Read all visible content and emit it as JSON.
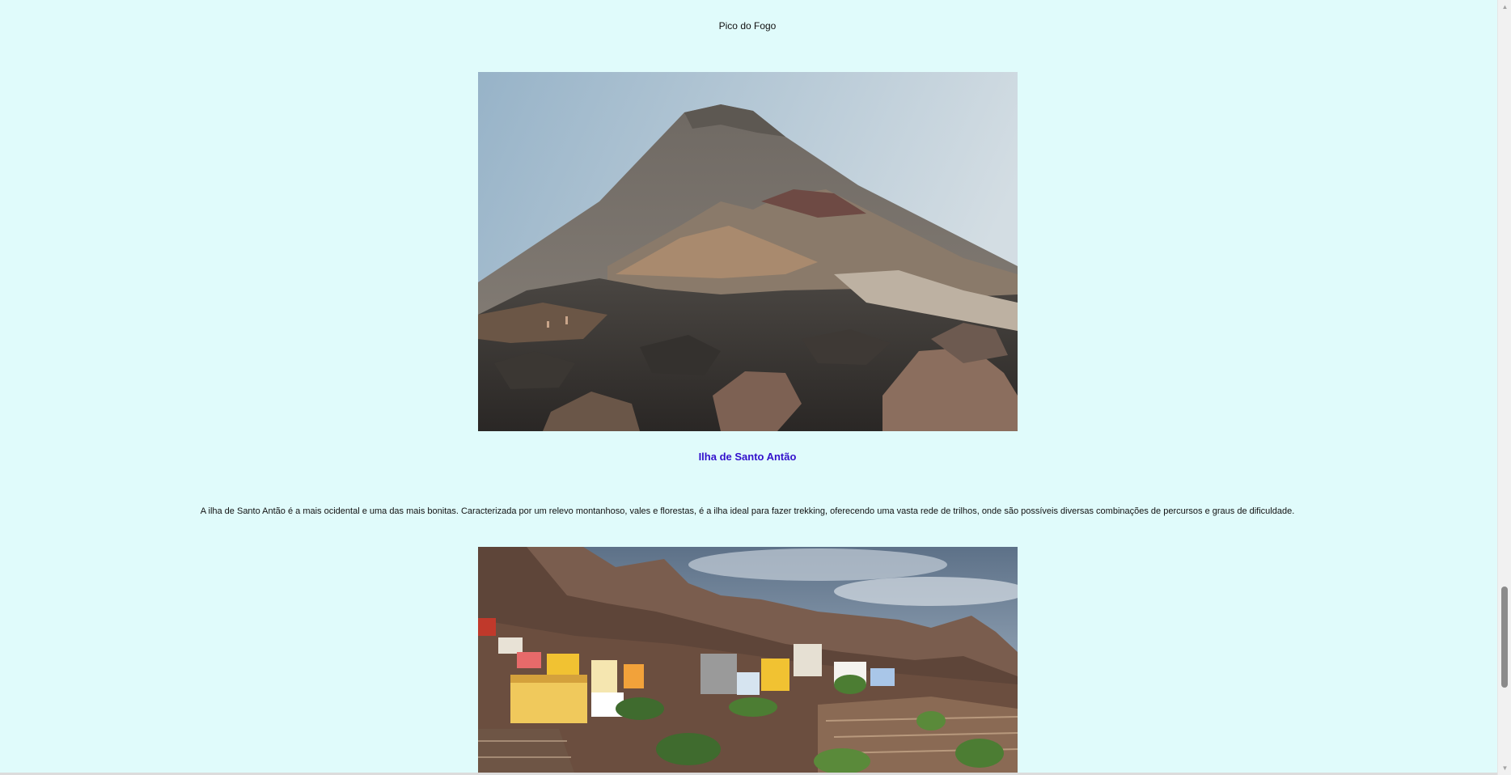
{
  "captions": {
    "fogo": "Pico do Fogo"
  },
  "santo_antao": {
    "title": "Ilha de Santo Antão",
    "description": "A ilha de Santo Antão é a mais ocidental e uma das mais bonitas. Caracterizada por um relevo montanhoso, vales e florestas, é a ilha ideal para fazer trekking, oferecendo uma vasta rede de trilhos, onde são possíveis diversas combinações de percursos e graus de dificuldade."
  },
  "colors": {
    "page_background": "#e0fbfb",
    "section_title": "#3311cc",
    "body_text": "#111111"
  },
  "icons": {
    "scroll_up": "triangle-up",
    "scroll_down": "triangle-down"
  },
  "scroll": {
    "position_fraction": 0.9
  }
}
